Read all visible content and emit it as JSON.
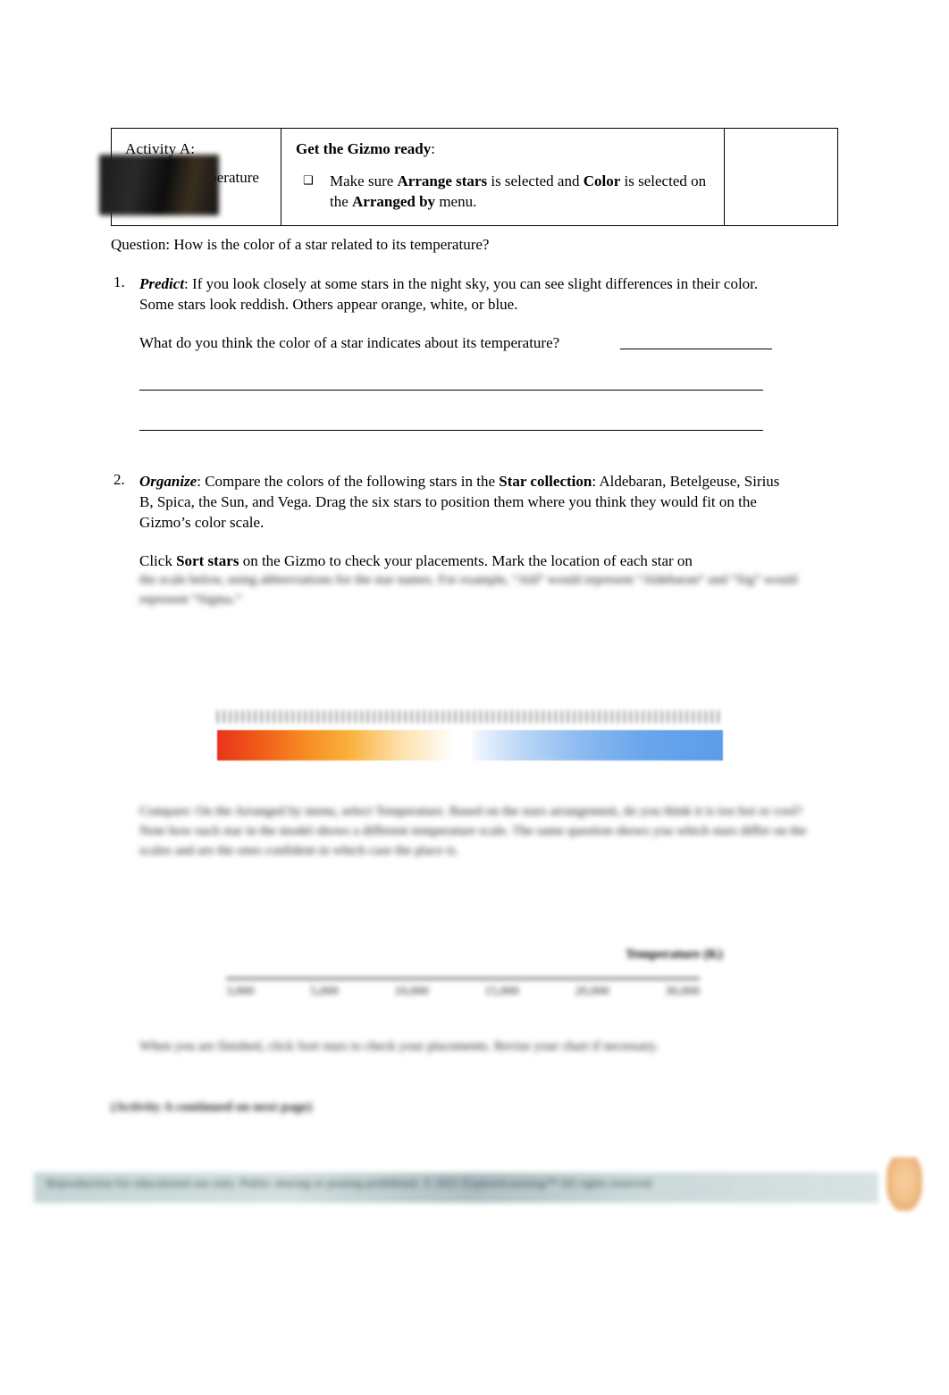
{
  "document": {
    "header_table": {
      "activity_title": "Activity A:",
      "activity_subtitle": "Color and temperature",
      "gizmo_ready_label": "Get the Gizmo ready",
      "gizmo_ready_colon": ":",
      "bullet_glyph": "❑",
      "bullet_text_parts": {
        "lead": "Make sure",
        "bold1": "Arrange stars",
        "mid1": "is selected and",
        "bold2": "Color",
        "mid2": "is selected on the",
        "bold3": "Arranged by",
        "tail": "menu."
      },
      "third_cell": ""
    },
    "question_line": "Question: How is the color of a star related to its temperature?",
    "items": [
      {
        "number": "1.",
        "label": "Predict",
        "label_suffix": ":",
        "text": "If you look closely at some stars in the night sky, you can see slight differences in their color. Some stars look reddish. Others appear orange, white, or blue.",
        "follow_up": "What do you think the color of a star indicates about its temperature?"
      },
      {
        "number": "2.",
        "label": "Organize",
        "label_suffix": ":",
        "text_part1": "Compare the colors of the following stars in the",
        "bold_phrase": "Star collection",
        "text_part2": ": Aldebaran, Betelgeuse, Sirius B, Spica, the Sun, and Vega. Drag the six stars to position them where you think they would fit on the Gizmo’s color scale.",
        "follow_up_part1": "Click",
        "follow_up_bold": "Sort stars",
        "follow_up_part2": "on the Gizmo to check your placements. Mark the location of each star on"
      }
    ],
    "redacted": {
      "note": "blurred-illegible",
      "block_after_item2": "the scale below, using abbreviations for the star names. For example, “Ald” would represent “Aldebaran” and “Sig” would represent “Sigma.”",
      "item3": "Compare: On the Arranged by menu, select Temperature. Based on the stars arrangement, do you think it is too hot or cool? Note how each star in the model shows a different temperature scale. The same question shows you which stars differ on the scales and are the ones confident in which case the place is.",
      "temperature_label": "Temperature (K)",
      "temperature_ticks": [
        "3,000",
        "5,000",
        "10,000",
        "15,000",
        "20,000",
        "30,000"
      ],
      "closing_line": "When you are finished, click Sort stars to check your placements. Revise your chart if necessary.",
      "activity_continued": "(Activity A continued on next page)"
    },
    "footer": {
      "text": "Reproduction for educational use only. Public sharing or posting prohibited. © 2021 ExploreLearning™ All rights reserved"
    },
    "color_scale": {
      "gradient_stops": [
        "#e8341c",
        "#f68a22",
        "#fbb03b",
        "#ffffff",
        "#bcd7f7",
        "#5b9ce9"
      ],
      "has_tick_marks": true
    }
  }
}
